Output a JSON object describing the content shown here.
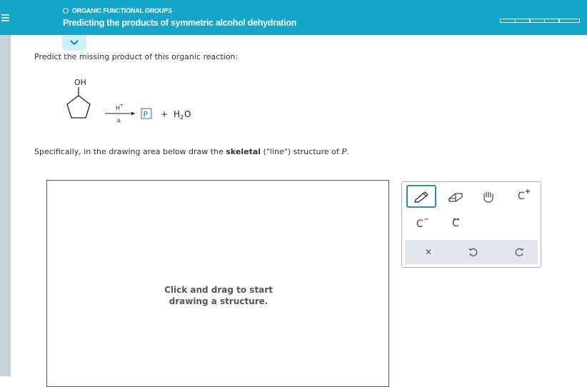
{
  "header": {
    "topic": "ORGANIC FUNCTIONAL GROUPS",
    "title": "Predicting the products of symmetric alcohol dehydration"
  },
  "question": {
    "prompt": "Predict the missing product of this organic reaction:",
    "reactant_label": "OH",
    "catalyst": "H",
    "catalyst_sup": "+",
    "heat": "Δ",
    "product_placeholder": "P",
    "plus": "+",
    "water_h": "H",
    "water_sub": "2",
    "water_o": "O",
    "instruction_pre": "Specifically, in the drawing area below draw the ",
    "instruction_bold": "skeletal",
    "instruction_mid": " (\"line\") structure of ",
    "instruction_var": "P",
    "instruction_end": "."
  },
  "canvas": {
    "hint": "Click and drag to start drawing a structure."
  },
  "toolbar": {
    "tools": [
      {
        "name": "pencil-tool",
        "icon": "pencil-icon",
        "active": true
      },
      {
        "name": "eraser-tool",
        "icon": "eraser-icon"
      },
      {
        "name": "move-tool",
        "icon": "hand-icon"
      },
      {
        "name": "add-positive-charge-tool",
        "label": "C",
        "sup": "+"
      },
      {
        "name": "add-negative-charge-tool",
        "label": "C",
        "sup": "−"
      },
      {
        "name": "add-lone-pair-tool",
        "label": "C",
        "dots": "··"
      },
      {
        "name": "clear-tool",
        "icon": "x-icon"
      },
      {
        "name": "undo-tool",
        "icon": "undo-icon"
      },
      {
        "name": "redo-tool",
        "icon": "redo-icon"
      }
    ],
    "charge_c": "C",
    "charge_plus": "+",
    "charge_minus": "−",
    "clear_glyph": "✕"
  },
  "colors": {
    "header_bg": "#14a5c8",
    "sidebar_bg": "#c8d2d9",
    "accent": "#2a8ab8",
    "product_box": "#2a6fb0"
  }
}
